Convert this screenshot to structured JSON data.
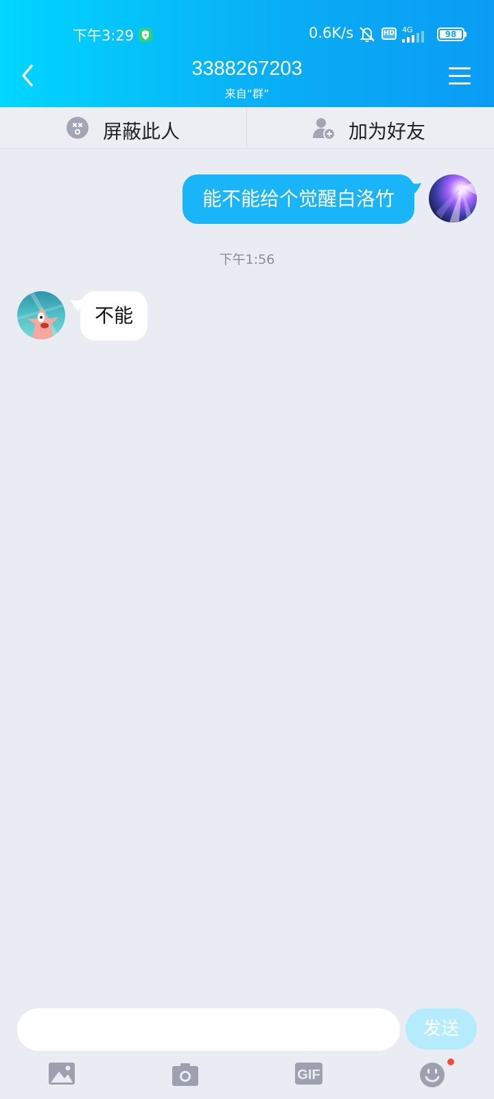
{
  "status_bar": {
    "time": "下午3:29",
    "network_speed": "0.6K/s",
    "network_type": "4G",
    "hd_label": "HD",
    "battery": "98"
  },
  "header": {
    "title": "3388267203",
    "subtitle": "来自“群”"
  },
  "actions": {
    "block_label": "屏蔽此人",
    "add_friend_label": "加为好友"
  },
  "messages": [
    {
      "side": "right",
      "text": "能不能给个觉醒白洛竹"
    },
    {
      "side": "left",
      "text": "不能"
    }
  ],
  "time_divider": "下午1:56",
  "composer": {
    "value": "",
    "send_label": "发送"
  },
  "toolbar": {
    "gif_label": "GIF"
  },
  "colors": {
    "header_start": "#00d6ff",
    "header_end": "#0a9cf5",
    "my_bubble": "#1ab4f8",
    "send_disabled": "#b5ecfd",
    "badge": "#f24b3c"
  }
}
